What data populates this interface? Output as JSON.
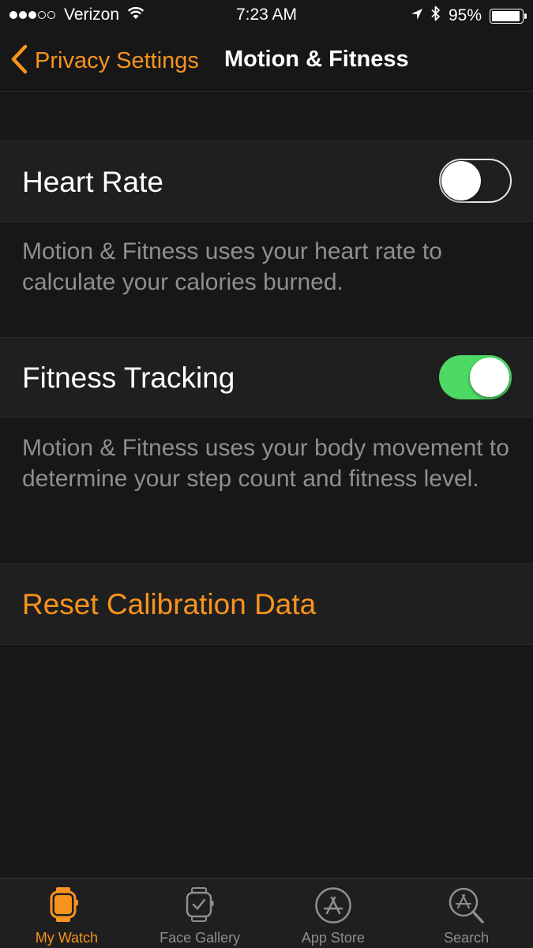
{
  "status_bar": {
    "carrier": "Verizon",
    "time": "7:23 AM",
    "battery": "95%",
    "battery_level": 0.95,
    "signal_strength": 3,
    "signal_max": 5,
    "icons": [
      "wifi-icon",
      "location-arrow-icon",
      "bluetooth-icon",
      "battery-icon"
    ]
  },
  "nav": {
    "back_label": "Privacy Settings",
    "title": "Motion & Fitness"
  },
  "settings": {
    "heart_rate": {
      "label": "Heart Rate",
      "enabled": false,
      "footer": "Motion & Fitness uses your heart rate to calculate your calories burned."
    },
    "fitness_tracking": {
      "label": "Fitness Tracking",
      "enabled": true,
      "footer": "Motion & Fitness uses your body movement to determine your step count and fitness level."
    },
    "reset_label": "Reset Calibration Data"
  },
  "tab_bar": {
    "tabs": [
      {
        "label": "My Watch",
        "icon": "watch-icon",
        "active": true
      },
      {
        "label": "Face Gallery",
        "icon": "watch-face-icon",
        "active": false
      },
      {
        "label": "App Store",
        "icon": "app-store-icon",
        "active": false
      },
      {
        "label": "Search",
        "icon": "search-icon",
        "active": false
      }
    ]
  },
  "colors": {
    "accent": "#f7931e",
    "toggle_on": "#4cd964",
    "background": "#171717",
    "cell_background": "#1f1f1f",
    "secondary_text": "#8e8e93"
  }
}
